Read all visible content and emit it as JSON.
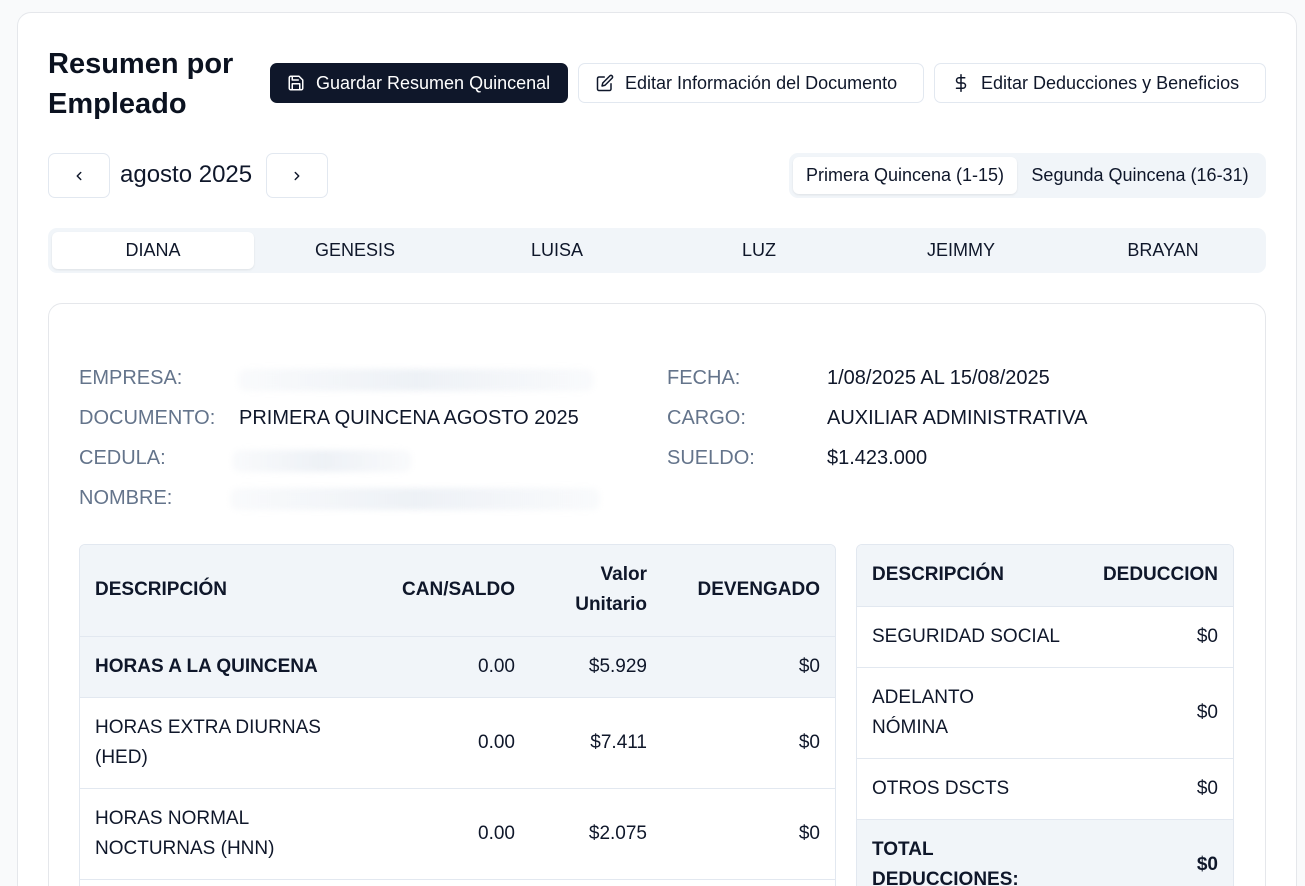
{
  "header": {
    "title": "Resumen por Empleado",
    "save_label": "Guardar Resumen Quincenal",
    "edit_doc_label": "Editar Información del Documento",
    "edit_ded_label": "Editar Deducciones y Beneficios"
  },
  "period": {
    "month": "agosto 2025",
    "options": [
      "Primera Quincena (1-15)",
      "Segunda Quincena (16-31)"
    ],
    "active": 0
  },
  "employees": [
    "DIANA",
    "GENESIS",
    "LUISA",
    "LUZ",
    "JEIMMY",
    "BRAYAN"
  ],
  "active_employee": 0,
  "info": {
    "empresa_label": "EMPRESA:",
    "documento_label": "DOCUMENTO:",
    "documento_value": "PRIMERA QUINCENA AGOSTO 2025",
    "cedula_label": "CEDULA:",
    "nombre_label": "NOMBRE:",
    "fecha_label": "FECHA:",
    "fecha_value": "1/08/2025 AL 15/08/2025",
    "cargo_label": "CARGO:",
    "cargo_value": "AUXILIAR ADMINISTRATIVA",
    "sueldo_label": "SUELDO:",
    "sueldo_value": "$1.423.000"
  },
  "earnings": {
    "headers": [
      "DESCRIPCIÓN",
      "CAN/SALDO",
      "Valor Unitario",
      "DEVENGADO"
    ],
    "rows": [
      {
        "desc": "HORAS A LA QUINCENA",
        "qty": "0.00",
        "unit": "$5.929",
        "total": "$0"
      },
      {
        "desc": "HORAS EXTRA DIURNAS (HED)",
        "qty": "0.00",
        "unit": "$7.411",
        "total": "$0"
      },
      {
        "desc": "HORAS NORMAL NOCTURNAS (HNN)",
        "qty": "0.00",
        "unit": "$2.075",
        "total": "$0"
      }
    ]
  },
  "deductions": {
    "headers": [
      "DESCRIPCIÓN",
      "DEDUCCION"
    ],
    "rows": [
      {
        "desc": "SEGURIDAD SOCIAL",
        "value": "$0"
      },
      {
        "desc": "ADELANTO NÓMINA",
        "value": "$0"
      },
      {
        "desc": "OTROS DSCTS",
        "value": "$0"
      }
    ],
    "total_label": "TOTAL DEDUCCIONES:",
    "total_value": "$0"
  }
}
